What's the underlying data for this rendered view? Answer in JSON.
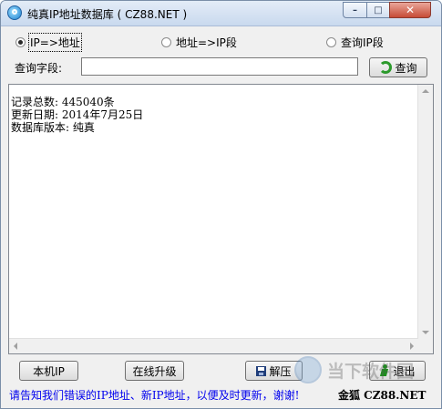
{
  "titlebar": {
    "title": "纯真IP地址数据库 ( CZ88.NET )",
    "minimize": "–",
    "maximize": "□",
    "close": "✕"
  },
  "mode": {
    "options": [
      {
        "label": "IP=>地址",
        "selected": true
      },
      {
        "label": "地址=>IP段",
        "selected": false
      },
      {
        "label": "查询IP段",
        "selected": false
      }
    ]
  },
  "query": {
    "label": "查询字段:",
    "value": "",
    "button": "查询"
  },
  "output": {
    "lines": [
      "记录总数: 445040条",
      "更新日期: 2014年7月25日",
      "数据库版本: 纯真"
    ]
  },
  "buttons": {
    "local_ip": "本机IP",
    "online_upgrade": "在线升级",
    "unpack": "解压",
    "exit": "退出"
  },
  "watermark": {
    "text": "当下软件园"
  },
  "status": {
    "message": "请告知我们错误的IP地址、新IP地址，以便及时更新，谢谢!",
    "brand": "金狐 CZ88.NET"
  }
}
